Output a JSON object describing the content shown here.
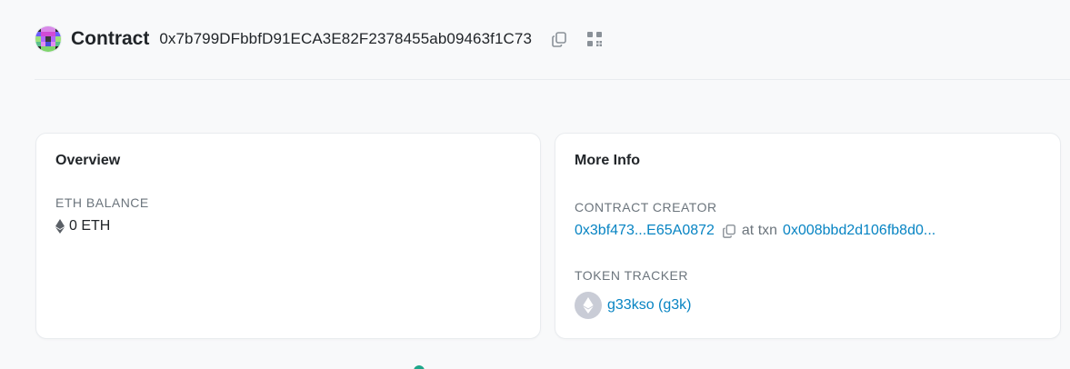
{
  "header": {
    "title": "Contract",
    "address": "0x7b799DFbbfD91ECA3E82F2378455ab09463f1C73",
    "copy_icon": "copy-icon",
    "qr_icon": "qr-code-icon"
  },
  "overview": {
    "title": "Overview",
    "eth_balance_label": "ETH BALANCE",
    "eth_balance_value": "0 ETH",
    "eth_icon": "ethereum-icon"
  },
  "more_info": {
    "title": "More Info",
    "contract_creator_label": "CONTRACT CREATOR",
    "creator_address": "0x3bf473...E65A0872",
    "at_txn_text": "at txn",
    "txn_hash": "0x008bbd2d106fb8d0...",
    "token_tracker_label": "TOKEN TRACKER",
    "token_name": "g33kso (g3k)",
    "token_icon": "ethereum-token-icon"
  },
  "colors": {
    "link": "#0784c3",
    "accent_teal": "#1fa78a",
    "muted": "#6c757d"
  }
}
